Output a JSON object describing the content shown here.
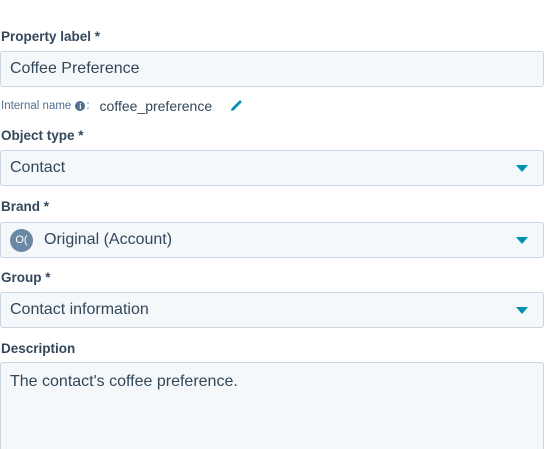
{
  "property_label": {
    "label": "Property label *",
    "value": "Coffee Preference"
  },
  "internal_name": {
    "label": "Internal name",
    "separator": ":",
    "info_glyph": "i",
    "value": "coffee_preference"
  },
  "object_type": {
    "label": "Object type *",
    "value": "Contact"
  },
  "brand": {
    "label": "Brand *",
    "badge": "O(",
    "value": "Original (Account)"
  },
  "group": {
    "label": "Group *",
    "value": "Contact information"
  },
  "description": {
    "label": "Description",
    "value": "The contact's coffee preference."
  },
  "colors": {
    "text": "#33475b",
    "field_bg": "#f5f8fa",
    "field_border": "#cbd6e2",
    "accent": "#0091ae",
    "badge_bg": "#6a87a3"
  }
}
